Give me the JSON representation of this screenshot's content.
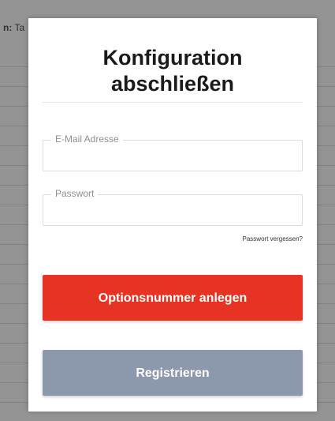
{
  "background": {
    "label_bold": "n:",
    "label_text": " Ta"
  },
  "modal": {
    "title_line1": "Konfiguration",
    "title_line2": "abschließen",
    "email": {
      "legend": "E-Mail Adresse",
      "value": ""
    },
    "password": {
      "legend": "Passwort",
      "value": ""
    },
    "forgot_password_label": "Passwort vergessen?",
    "primary_button_label": "Optionsnummer anlegen",
    "secondary_button_label": "Registrieren"
  },
  "colors": {
    "primary_button": "#e63323",
    "secondary_button": "#8c99ad",
    "overlay": "rgba(60, 60, 60, 0.55)"
  }
}
